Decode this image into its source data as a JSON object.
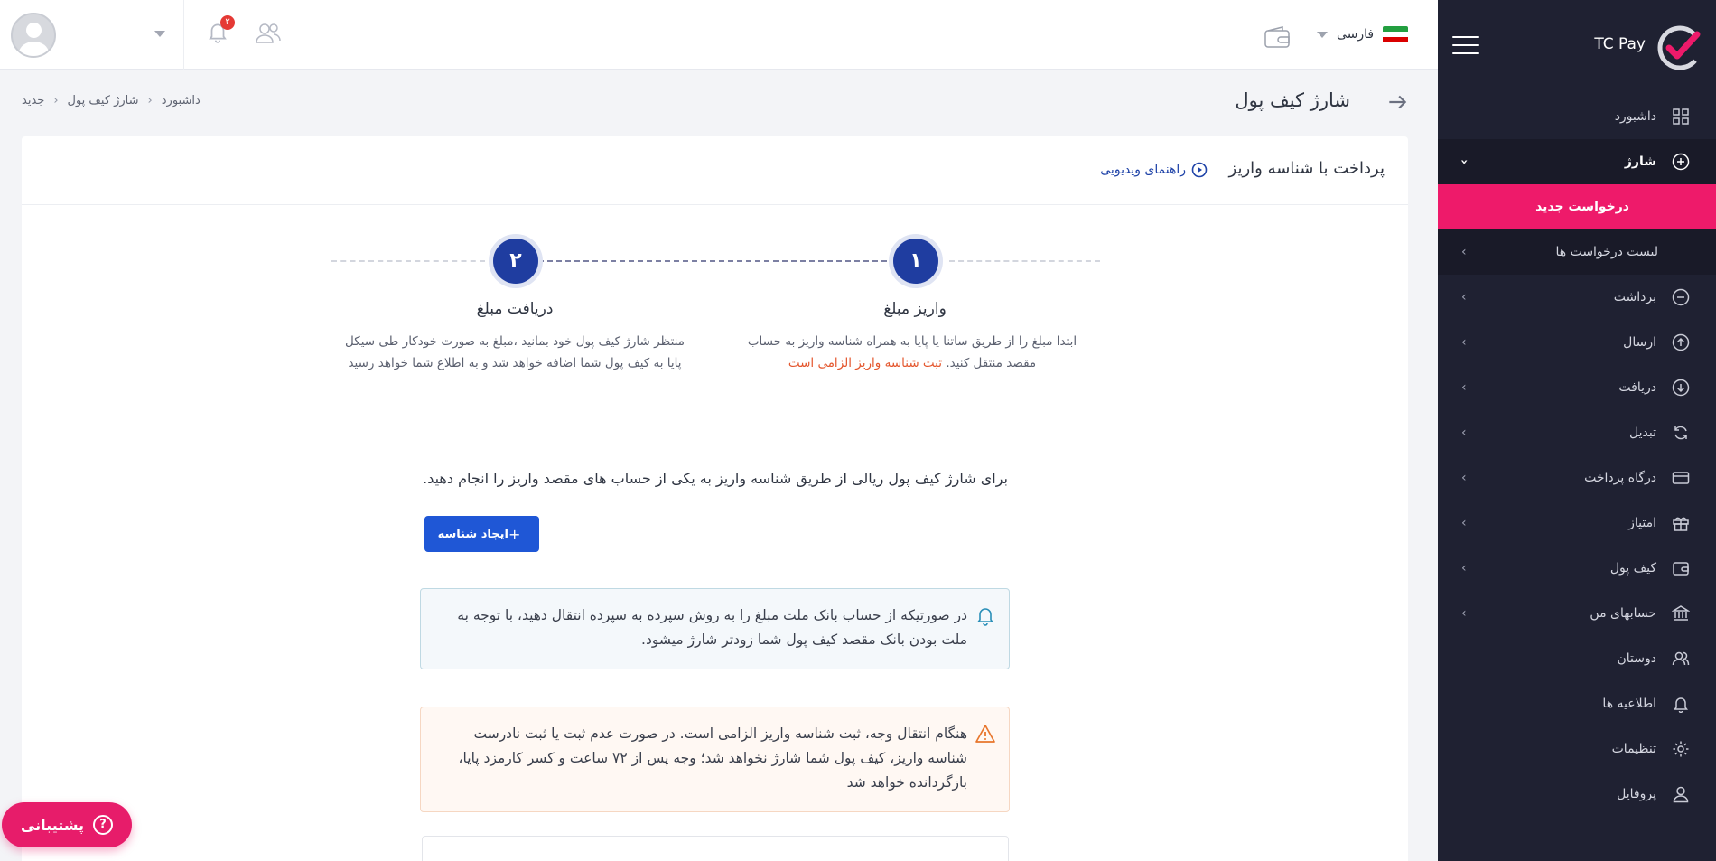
{
  "brand": {
    "name": "TC Pay"
  },
  "topbar": {
    "language": "فارسی",
    "notification_count": "۲"
  },
  "sidebar": {
    "items": [
      {
        "label": "داشبورد",
        "icon": "grid-icon"
      },
      {
        "label": "شارژ",
        "icon": "plus-circle-icon"
      },
      {
        "label": "درخواست جدید"
      },
      {
        "label": "لیست درخواست ها"
      },
      {
        "label": "برداشت",
        "icon": "minus-circle-icon"
      },
      {
        "label": "ارسال",
        "icon": "arrow-up-circle-icon"
      },
      {
        "label": "دریافت",
        "icon": "arrow-down-circle-icon"
      },
      {
        "label": "تبدیل",
        "icon": "refresh-icon"
      },
      {
        "label": "درگاه پرداخت",
        "icon": "credit-card-icon"
      },
      {
        "label": "امتیاز",
        "icon": "gift-icon"
      },
      {
        "label": "کیف پول",
        "icon": "wallet-icon"
      },
      {
        "label": "حسابهای من",
        "icon": "bank-icon"
      },
      {
        "label": "دوستان",
        "icon": "users-icon"
      },
      {
        "label": "اطلاعیه ها",
        "icon": "bell-icon"
      },
      {
        "label": "تنظیمات",
        "icon": "gear-icon"
      },
      {
        "label": "پروفایل",
        "icon": "user-icon"
      }
    ]
  },
  "page": {
    "title": "شارژ کیف پول",
    "breadcrumb": [
      "داشبورد",
      "شارژ کیف پول",
      "جدید"
    ]
  },
  "card": {
    "title": "پرداخت با شناسه واریز",
    "video_guide": "راهنمای ویدیویی",
    "steps": [
      {
        "number": "۱",
        "title": "واریز مبلغ",
        "desc_line1": "ابتدا مبلغ را از طریق ساتنا یا پایا به همراه شناسه واریز به حساب",
        "desc_line2": "مقصد منتقل کنید.",
        "desc_red": "ثبت شناسه واریز الزامی است"
      },
      {
        "number": "۲",
        "title": "دریافت مبلغ",
        "desc_line1": "منتظر شارژ کیف پول خود بمانید ،مبلغ به صورت خودکار طی سیکل",
        "desc_line2": "پایا به کیف پول شما اضافه خواهد شد و به اطلاع شما خواهد رسید"
      }
    ],
    "intro": "برای شارژ کیف پول ریالی از طریق شناسه واریز به یکی از حساب های مقصد واریز را انجام دهید.",
    "create_button": "ایجاد شناسه",
    "info_alert": "در صورتیکه از حساب بانک ملت مبلغ را به روش سپرده به سپرده انتقال دهید، با توجه به ملت بودن بانک مقصد کیف پول شما زودتر شارژ میشود.",
    "warn_alert": "هنگام انتقال وجه، ثبت شناسه واریز الزامی است. در صورت عدم ثبت یا ثبت نادرست شناسه واریز، کیف پول شما شارژ نخواهد شد؛ وجه پس از ۷۲ ساعت و کسر کارمزد پایا، بازگردانده خواهد شد"
  },
  "support_button": "پشتیبانی",
  "colors": {
    "sidebar_bg": "#1f2132",
    "accent_pink": "#ee1a6a",
    "primary_blue": "#1f57d6",
    "step_blue": "#1f3da0"
  }
}
